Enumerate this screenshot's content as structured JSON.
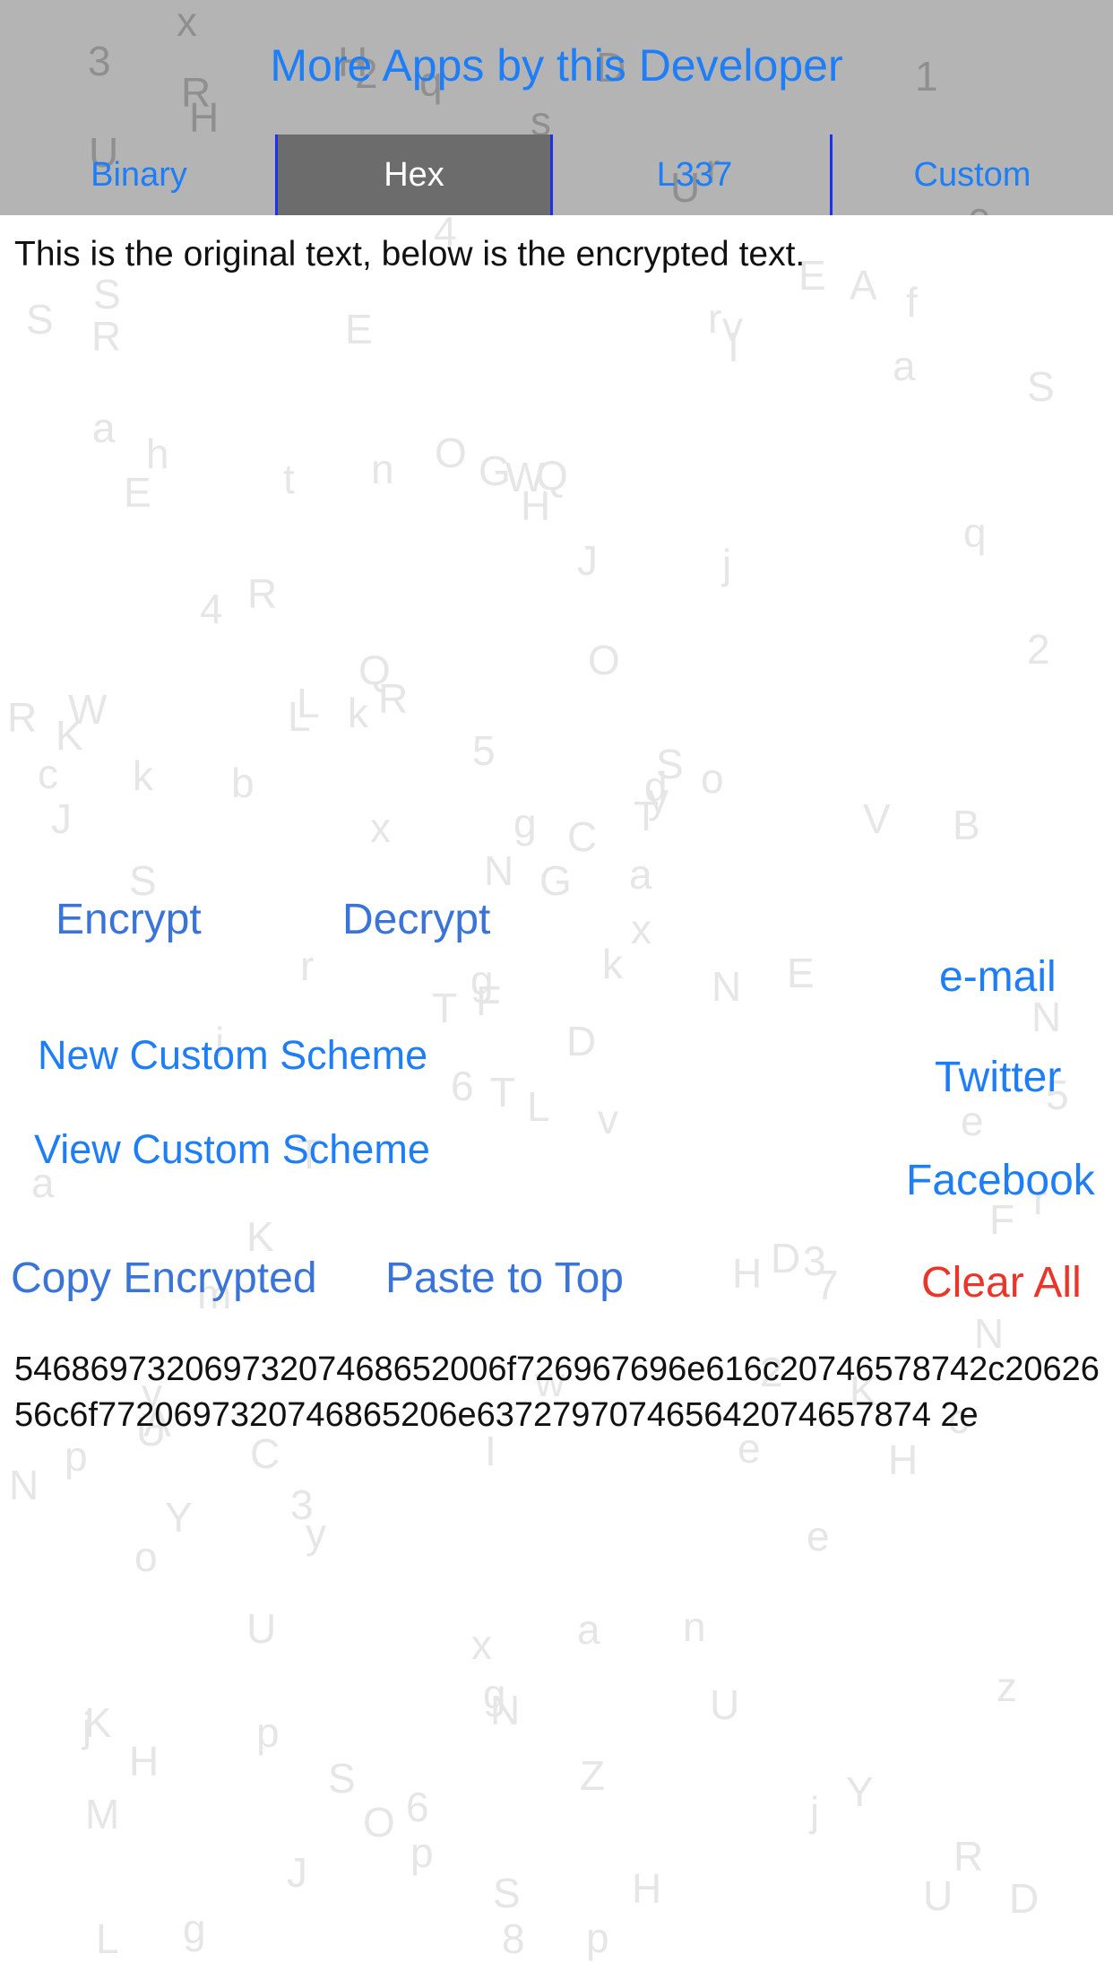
{
  "header": {
    "more_apps_label": "More Apps by this Developer",
    "tabs": [
      {
        "label": "Binary",
        "selected": false
      },
      {
        "label": "Hex",
        "selected": true
      },
      {
        "label": "L337",
        "selected": false
      },
      {
        "label": "Custom",
        "selected": false
      }
    ]
  },
  "original_text": "This is the original text, below is the encrypted text.",
  "actions": {
    "encrypt": "Encrypt",
    "decrypt": "Decrypt",
    "new_custom_scheme": "New Custom Scheme",
    "view_custom_scheme": "View Custom Scheme",
    "copy_encrypted": "Copy Encrypted",
    "paste_to_top": "Paste to Top",
    "clear_all": "Clear All"
  },
  "share": {
    "email": "e-mail",
    "twitter": "Twitter",
    "facebook": "Facebook"
  },
  "encrypted_text": "54686973206973207468652006f726967696e616c20746578742c2062656c6f7720697320746865206e637279707465642074657874 2e",
  "colors": {
    "accent": "#1e7ef7",
    "button_blue": "#3a74d8",
    "danger": "#e8372a",
    "header_bg": "#b4b4b4",
    "segment_selected_bg": "#6c6c6c",
    "segment_divider": "#1f30e8"
  }
}
